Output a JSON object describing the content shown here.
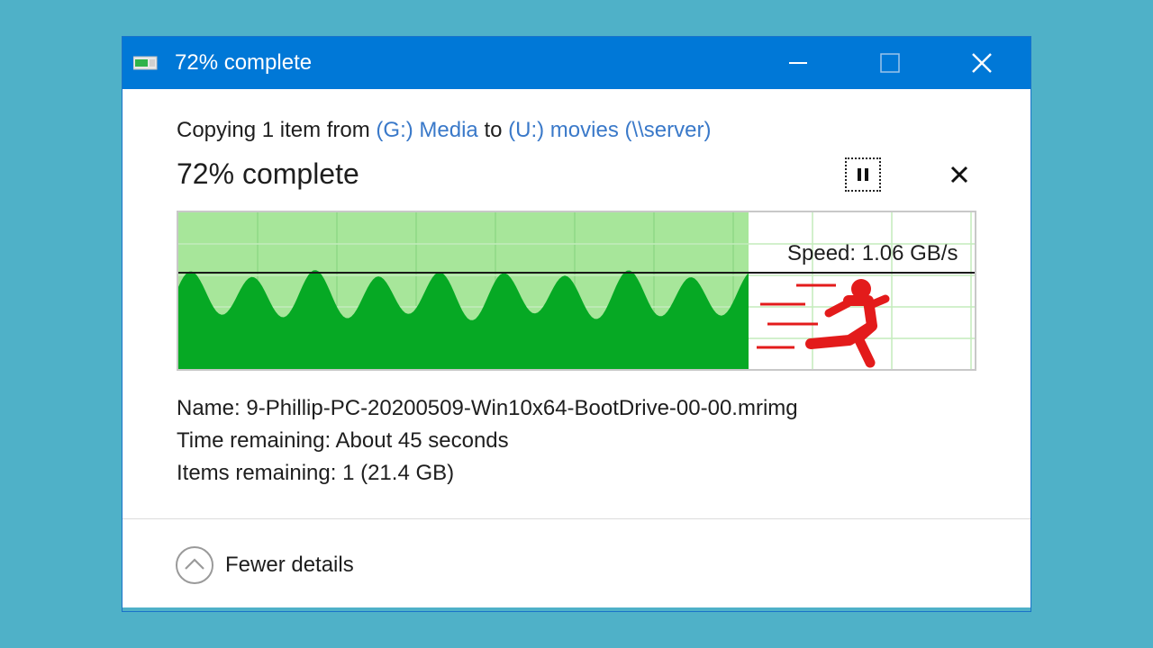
{
  "window": {
    "title": "72% complete",
    "accent_color": "#0078d7"
  },
  "header": {
    "copying_prefix": "Copying 1 item from",
    "source": "(G:) Media",
    "to_word": "to",
    "destination": "(U:) movies (\\\\server)",
    "progress_heading": "72% complete",
    "progress_fraction": 0.72
  },
  "graph": {
    "speed_label": "Speed: 1.06 GB/s",
    "fill_color": "#06a924",
    "area_color": "#a7e69a",
    "grid_color": "#c3ecbc",
    "runner_color": "#e31b1b",
    "icon": "running-man-icon"
  },
  "details": {
    "name_label": "Name:",
    "name_value": "9-Phillip-PC-20200509-Win10x64-BootDrive-00-00.mrimg",
    "time_label": "Time remaining:",
    "time_value": "About 45 seconds",
    "items_label": "Items remaining:",
    "items_value": "1 (21.4 GB)"
  },
  "footer": {
    "toggle_label": "Fewer details",
    "toggle_icon": "chevron-up-circle-icon"
  }
}
